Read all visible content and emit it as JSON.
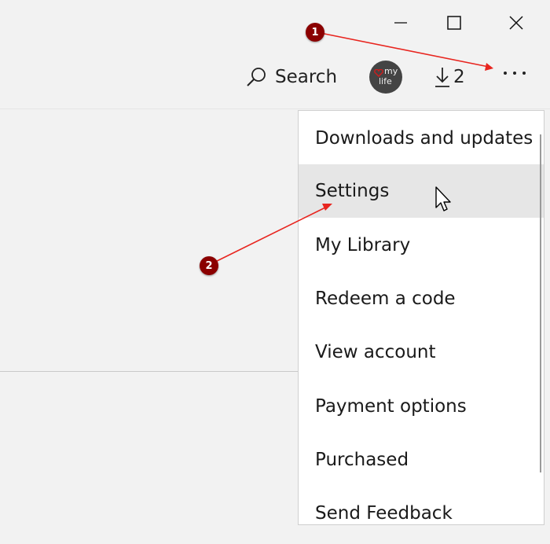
{
  "window": {
    "controls": [
      "minimize",
      "maximize",
      "close"
    ]
  },
  "toolbar": {
    "search_label": "Search",
    "avatar_text_top": "my",
    "avatar_text_bottom": "life",
    "downloads_count": "2",
    "more_icon": "ellipsis-icon"
  },
  "menu": {
    "items": [
      {
        "label": "Downloads and updates"
      },
      {
        "label": "Settings"
      },
      {
        "label": "My Library"
      },
      {
        "label": "Redeem a code"
      },
      {
        "label": "View account"
      },
      {
        "label": "Payment options"
      },
      {
        "label": "Purchased"
      },
      {
        "label": "Send Feedback"
      }
    ],
    "hovered_item": "Settings"
  },
  "annotations": {
    "badge_1": "1",
    "badge_2": "2",
    "arrow_color": "#e8251f",
    "badge_color": "#8b0000"
  }
}
